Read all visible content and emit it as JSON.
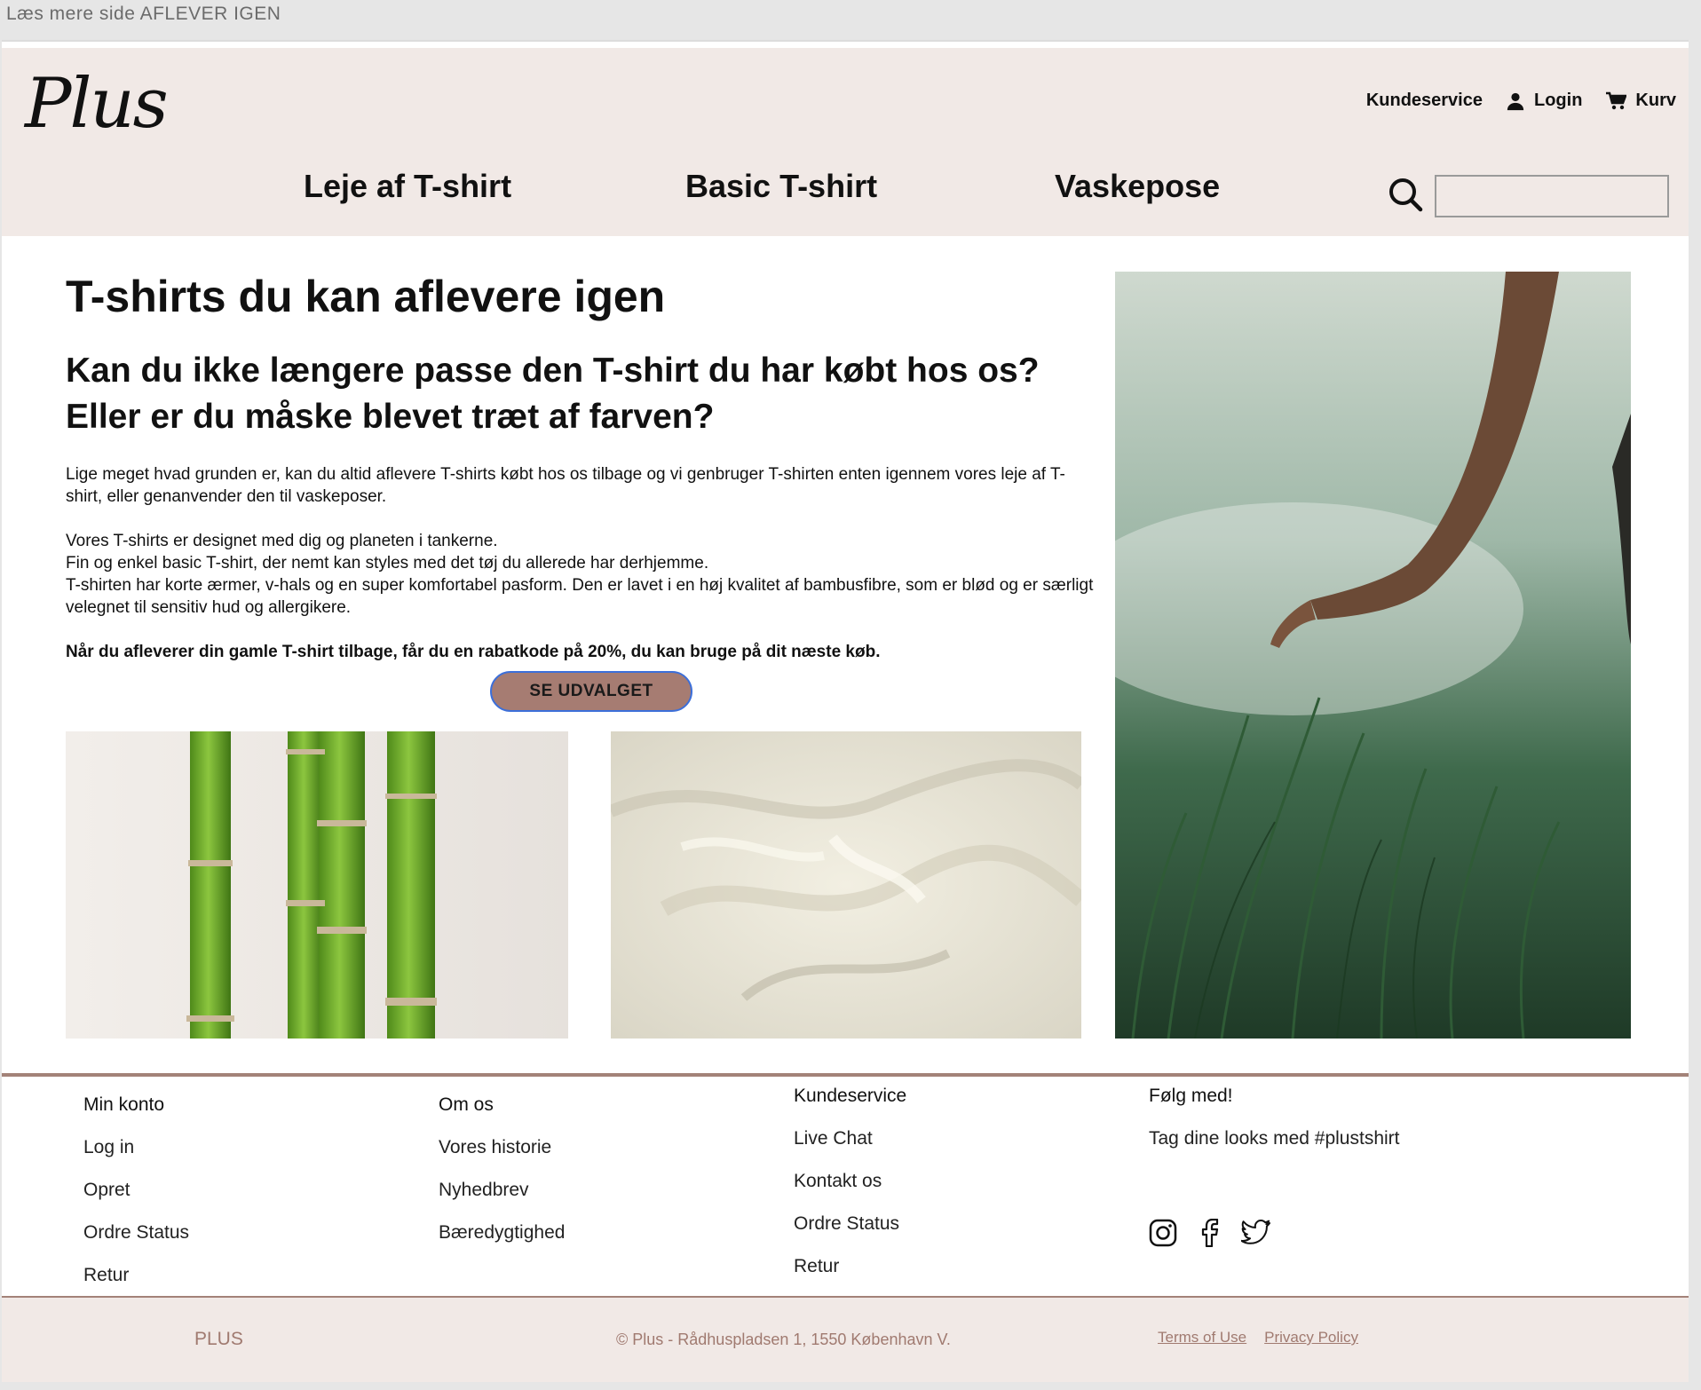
{
  "browser": {
    "tab_label": "Læs mere side AFLEVER IGEN"
  },
  "header": {
    "logo": "Plus",
    "utility": {
      "customer_service": "Kundeservice",
      "login": "Login",
      "cart": "Kurv"
    },
    "nav": [
      "Leje af T-shirt",
      "Basic T-shirt",
      "Vaskepose"
    ],
    "search": {
      "value": "",
      "placeholder": ""
    }
  },
  "main": {
    "title": "T-shirts du kan aflevere igen",
    "subtitle_line1": "Kan du ikke længere passe den T-shirt du har købt hos os?",
    "subtitle_line2": "Eller er du måske blevet træt af farven?",
    "paragraph1": "Lige meget hvad grunden er, kan du altid aflevere T-shirts købt hos os tilbage og vi genbruger T-shirten enten igennem vores leje af T-shirt, eller genanvender den til vaskeposer.",
    "paragraph2_lines": [
      "Vores T-shirts er designet med dig og planeten i tankerne.",
      "Fin og enkel basic T-shirt, der nemt kan styles med det tøj du allerede har derhjemme.",
      "T-shirten har korte ærmer, v-hals og en super komfortabel pasform. Den er lavet i en høj kvalitet af bambusfibre, som er blød og er særligt velegnet til sensitiv hud og allergikere."
    ],
    "paragraph3": "Når du afleverer din gamle T-shirt tilbage, får du en rabatkode på 20%, du kan bruge på dit næste køb.",
    "cta": "SE UDVALGET"
  },
  "footer": {
    "columns": [
      {
        "title": "Min konto",
        "links": [
          "Log in",
          "Opret",
          "Ordre Status",
          "Retur"
        ]
      },
      {
        "title": "Om os",
        "links": [
          "Vores historie",
          "Nyhedbrev",
          "Bæredygtighed"
        ]
      },
      {
        "title": "Kundeservice",
        "links": [
          "Live Chat",
          "Kontakt os",
          "Ordre Status",
          "Retur"
        ]
      },
      {
        "title": "Følg med!",
        "links": [
          "Tag dine looks med #plustshirt"
        ]
      }
    ],
    "social_icons": [
      "instagram-icon",
      "facebook-icon",
      "twitter-icon"
    ],
    "brand": "PLUS",
    "copyright": "© Plus - Rådhuspladsen 1, 1550 København V.",
    "legal": [
      "Terms of Use",
      "Privacy Policy"
    ]
  },
  "colors": {
    "header_bg": "#f1e9e6",
    "accent": "#a67c72",
    "footer_text": "#a07a70",
    "button_border": "#3c6fd9"
  }
}
